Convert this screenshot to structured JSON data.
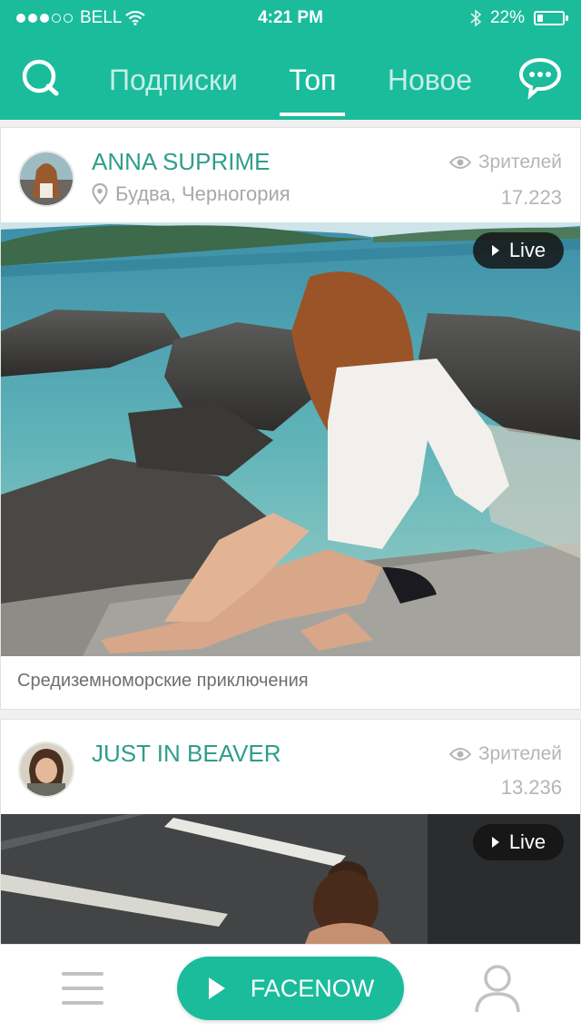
{
  "status_bar": {
    "carrier": "BELL",
    "time": "4:21 PM",
    "battery_text": "22%",
    "battery_level": 0.22
  },
  "header": {
    "tabs": [
      {
        "label": "Подписки",
        "active": false
      },
      {
        "label": "Топ",
        "active": true
      },
      {
        "label": "Новое",
        "active": false
      }
    ],
    "icons": {
      "left": "search-icon",
      "right": "chat-icon"
    }
  },
  "feed": [
    {
      "name": "ANNA SUPRIME",
      "location": "Будва, Черногория",
      "viewers_label": "Зрителей",
      "viewers_count": "17.223",
      "live_label": "Live",
      "caption": "Средиземноморские приключения"
    },
    {
      "name": "JUST IN BEAVER",
      "location": "",
      "viewers_label": "Зрителей",
      "viewers_count": "13.236",
      "live_label": "Live",
      "caption": ""
    }
  ],
  "bottom_bar": {
    "center_label": "FACENOW"
  },
  "colors": {
    "accent": "#1abc9c",
    "name_text": "#2f9e89",
    "muted_text": "#a8a8a8"
  }
}
